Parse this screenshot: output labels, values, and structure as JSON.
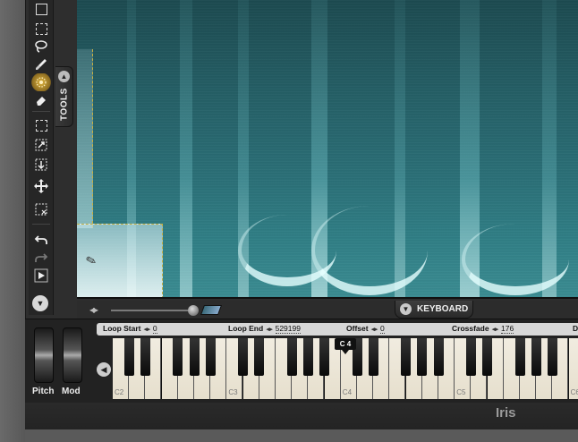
{
  "tools_tab": {
    "label": "TOOLS"
  },
  "keyboard_tab": {
    "label": "KEYBOARD"
  },
  "loop_bar": {
    "loop_start_label": "Loop Start",
    "loop_start_value": "0",
    "loop_end_label": "Loop End",
    "loop_end_value": "529199",
    "offset_label": "Offset",
    "offset_value": "0",
    "crossfade_label": "Crossfade",
    "crossfade_value": "176",
    "extra_label": "D"
  },
  "wheels": {
    "pitch_label": "Pitch",
    "mod_label": "Mod"
  },
  "piano": {
    "marker_label": "C 4",
    "note_labels": [
      "C2",
      "C3",
      "C4",
      "C5",
      "C6"
    ]
  },
  "footer": {
    "brand": "Iris"
  },
  "icons": {
    "tools": [
      "rect-select-icon",
      "lasso-icon",
      "brush-icon",
      "magic-wand-icon",
      "eraser-icon",
      "transform-icon",
      "scale-icon",
      "move-down-icon",
      "move-icon",
      "clear-selection-icon",
      "undo-icon",
      "redo-icon",
      "play-icon"
    ],
    "active_tool": "magic-wand-icon"
  },
  "colors": {
    "spectrogram": "#2a7078",
    "selection_outline": "#c9b040",
    "key_white": "#f1ece0"
  }
}
